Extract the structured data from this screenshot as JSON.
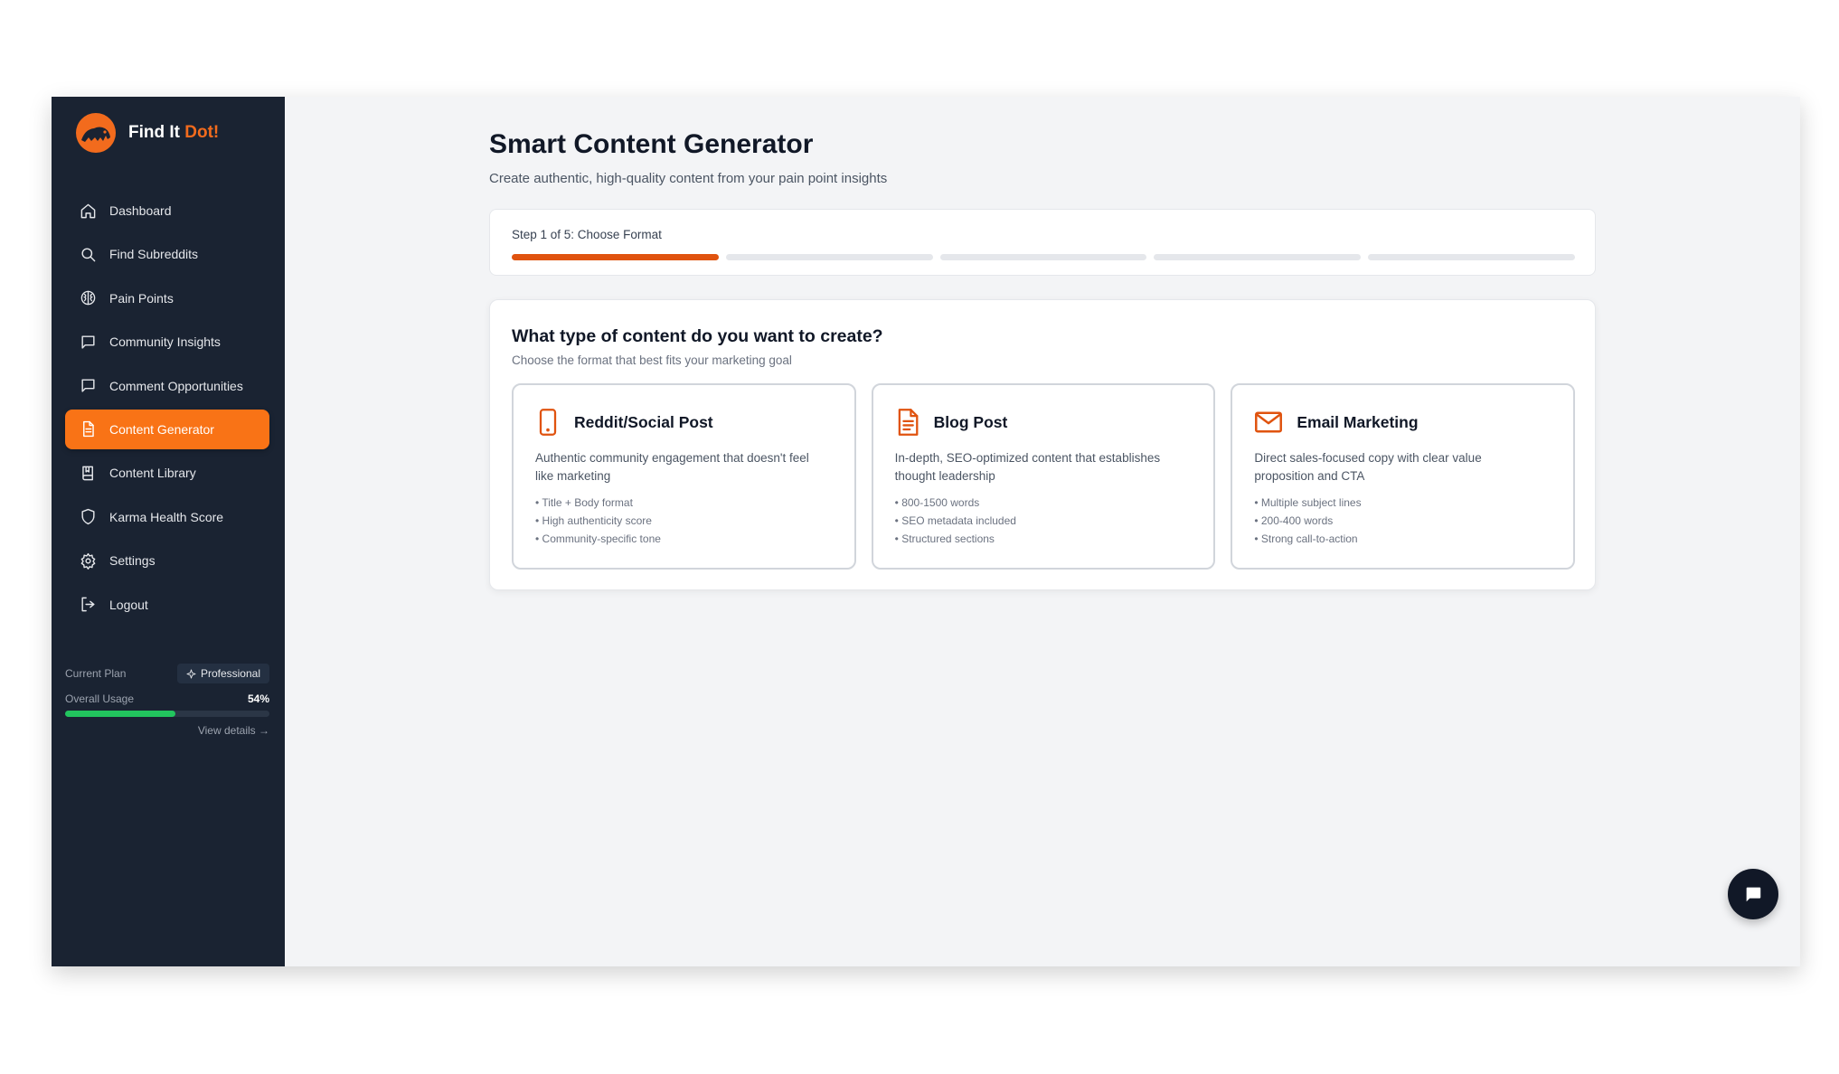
{
  "brand": {
    "name_main": "Find It",
    "name_accent": "Dot!"
  },
  "sidebar": {
    "items": [
      {
        "label": "Dashboard",
        "icon": "home-icon"
      },
      {
        "label": "Find Subreddits",
        "icon": "search-icon"
      },
      {
        "label": "Pain Points",
        "icon": "brain-icon"
      },
      {
        "label": "Community Insights",
        "icon": "message-square-icon"
      },
      {
        "label": "Comment Opportunities",
        "icon": "message-square-icon"
      },
      {
        "label": "Content Generator",
        "icon": "file-text-icon",
        "active": true
      },
      {
        "label": "Content Library",
        "icon": "book-icon"
      },
      {
        "label": "Karma Health Score",
        "icon": "shield-icon"
      },
      {
        "label": "Settings",
        "icon": "gear-icon"
      },
      {
        "label": "Logout",
        "icon": "logout-icon"
      }
    ],
    "plan": {
      "label": "Current Plan",
      "badge": "Professional",
      "usage_label": "Overall Usage",
      "usage_value": "54%",
      "usage_fraction": 0.54,
      "view_details": "View details →"
    }
  },
  "main": {
    "title": "Smart Content Generator",
    "subtitle": "Create authentic, high-quality content from your pain point insights",
    "step": {
      "label": "Step 1 of 5:  Choose Format",
      "current": 1,
      "total": 5
    },
    "question": {
      "title": "What type of content do you want to create?",
      "subtitle": "Choose the format that best fits your marketing goal"
    },
    "options": [
      {
        "title": "Reddit/Social Post",
        "icon": "smartphone-icon",
        "description": "Authentic community engagement that doesn't feel like marketing",
        "bullets": [
          "• Title + Body format",
          "• High authenticity score",
          "• Community-specific tone"
        ]
      },
      {
        "title": "Blog Post",
        "icon": "document-icon",
        "description": "In-depth, SEO-optimized content that establishes thought leadership",
        "bullets": [
          "• 800-1500 words",
          "• SEO metadata included",
          "• Structured sections"
        ]
      },
      {
        "title": "Email Marketing",
        "icon": "mail-icon",
        "description": "Direct sales-focused copy with clear value proposition and CTA",
        "bullets": [
          "• Multiple subject lines",
          "• 200-400 words",
          "• Strong call-to-action"
        ]
      }
    ]
  },
  "colors": {
    "accent": "#f97316",
    "sidebar_bg": "#1a2332",
    "usage_green": "#22c55e",
    "step_done": "#e0530f"
  }
}
